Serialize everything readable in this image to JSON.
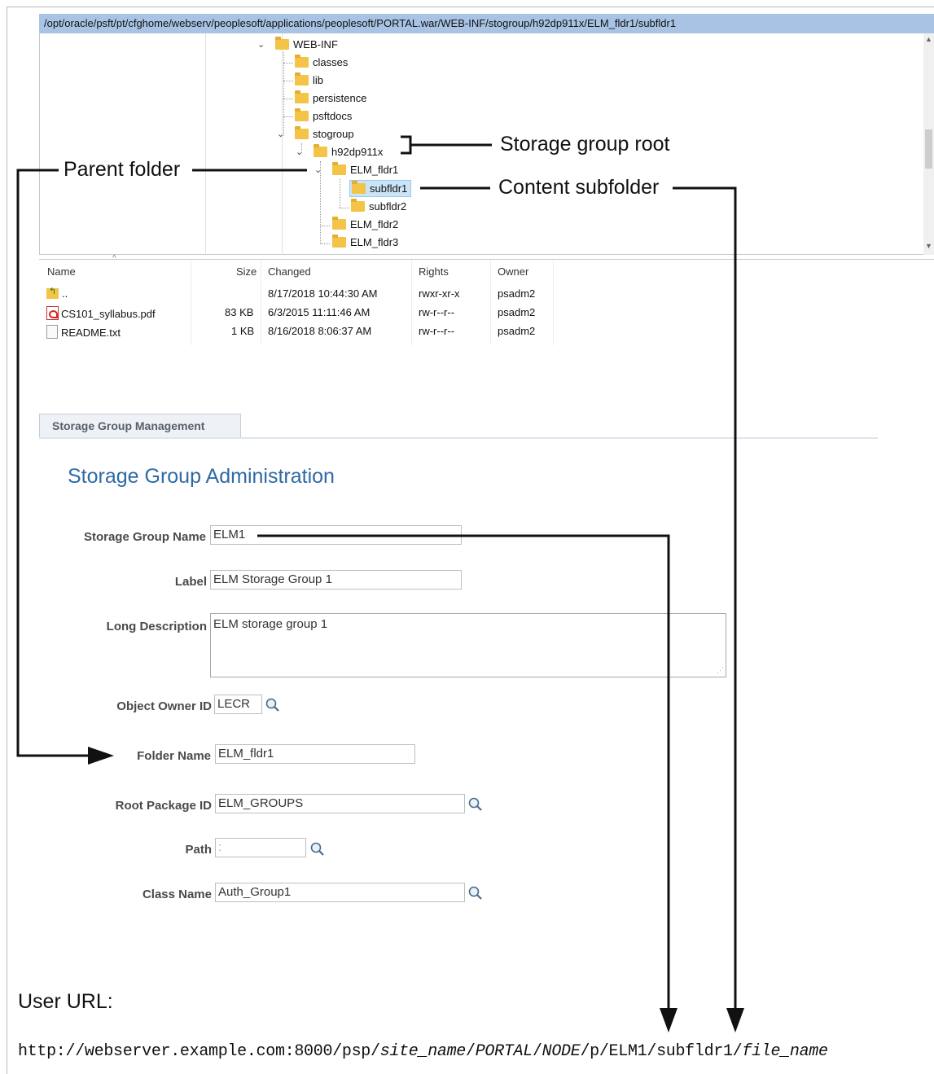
{
  "explorer": {
    "path": "/opt/oracle/psft/pt/cfghome/webserv/peoplesoft/applications/peoplesoft/PORTAL.war/WEB-INF/stogroup/h92dp911x/ELM_fldr1/subfldr1",
    "tree": {
      "web_inf": "WEB-INF",
      "classes": "classes",
      "lib": "lib",
      "persistence": "persistence",
      "psftdocs": "psftdocs",
      "stogroup": "stogroup",
      "h92dp911x": "h92dp911x",
      "elm_fldr1": "ELM_fldr1",
      "subfldr1": "subfldr1",
      "subfldr2": "subfldr2",
      "elm_fldr2": "ELM_fldr2",
      "elm_fldr3": "ELM_fldr3"
    },
    "columns": {
      "name": "Name",
      "size": "Size",
      "changed": "Changed",
      "rights": "Rights",
      "owner": "Owner"
    },
    "files": [
      {
        "name": "..",
        "size": "",
        "changed": "8/17/2018 10:44:30 AM",
        "rights": "rwxr-xr-x",
        "owner": "psadm2",
        "icon": "parent-folder-icon"
      },
      {
        "name": "CS101_syllabus.pdf",
        "size": "83 KB",
        "changed": "6/3/2015 11:11:46 AM",
        "rights": "rw-r--r--",
        "owner": "psadm2",
        "icon": "pdf-file-icon"
      },
      {
        "name": "README.txt",
        "size": "1 KB",
        "changed": "8/16/2018 8:06:37 AM",
        "rights": "rw-r--r--",
        "owner": "psadm2",
        "icon": "text-file-icon"
      }
    ]
  },
  "callouts": {
    "storage_group_root": "Storage group root",
    "parent_folder": "Parent folder",
    "content_subfolder": "Content subfolder"
  },
  "page": {
    "tab": "Storage Group Management",
    "title": "Storage Group Administration",
    "fields": {
      "storage_group_name": {
        "label": "Storage Group Name",
        "value": "ELM1"
      },
      "label": {
        "label": "Label",
        "value": "ELM Storage Group 1"
      },
      "long_description": {
        "label": "Long Description",
        "value": "ELM storage group 1"
      },
      "object_owner_id": {
        "label": "Object Owner ID",
        "value": "LECR"
      },
      "folder_name": {
        "label": "Folder Name",
        "value": "ELM_fldr1"
      },
      "root_package_id": {
        "label": "Root Package ID",
        "value": "ELM_GROUPS"
      },
      "path": {
        "label": "Path",
        "value": ":"
      },
      "class_name": {
        "label": "Class Name",
        "value": "Auth_Group1"
      }
    }
  },
  "url": {
    "label": "User URL:",
    "parts": {
      "p1": "http://webserver.example.com:8000/psp/",
      "site": "site_name",
      "p2": "/",
      "portal": "PORTAL",
      "p3": "/",
      "node": "NODE",
      "p4": "/p/ELM1/subfldr1/",
      "file": "file_name"
    }
  },
  "colors": {
    "path_bar": "#a9c3e4",
    "title": "#2f6aa3",
    "selection": "#cce4f7",
    "folder": "#f3c447"
  }
}
